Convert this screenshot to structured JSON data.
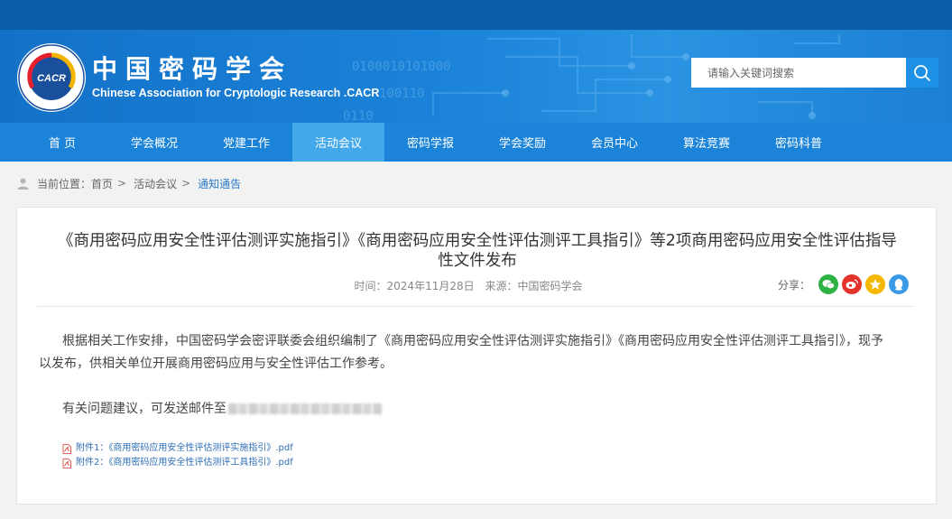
{
  "header": {
    "logo_text": "CACR",
    "site_title": "中国密码学会",
    "site_subtitle": "Chinese Association for Cryptologic Research .CACR",
    "search_placeholder": "请输入关键词搜索"
  },
  "nav": {
    "items": [
      {
        "label": "首 页"
      },
      {
        "label": "学会概况"
      },
      {
        "label": "党建工作"
      },
      {
        "label": "活动会议"
      },
      {
        "label": "密码学报"
      },
      {
        "label": "学会奖励"
      },
      {
        "label": "会员中心"
      },
      {
        "label": "算法竞赛"
      },
      {
        "label": "密码科普"
      }
    ],
    "active_index": 3
  },
  "breadcrumb": {
    "prefix": "当前位置：",
    "home": "首页",
    "section": "活动会议",
    "current": "通知通告",
    "sep": ">"
  },
  "article": {
    "title": "《商用密码应用安全性评估测评实施指引》《商用密码应用安全性评估测评工具指引》等2项商用密码应用安全性评估指导性文件发布",
    "time": "时间：2024年11月28日",
    "source": "来源：中国密码学会",
    "share_label": "分享：",
    "paragraph1": "根据相关工作安排，中国密码学会密评联委会组织编制了《商用密码应用安全性评估测评实施指引》《商用密码应用安全性评估测评工具指引》，现予以发布，供相关单位开展商用密码应用与安全性评估工作参考。",
    "paragraph2": "有关问题建议，可发送邮件至",
    "attachments": [
      {
        "label": "附件1：《商用密码应用安全性评估测评实施指引》.pdf"
      },
      {
        "label": "附件2：《商用密码应用安全性评估测评工具指引》.pdf"
      }
    ]
  },
  "colors": {
    "nav_bg": "#1b84d8",
    "nav_active": "#42a8ea",
    "link": "#2a7bc6",
    "wechat": "#2fb245",
    "weibo": "#e6332a",
    "qzone": "#f5b800",
    "qq": "#3a9ae8"
  }
}
